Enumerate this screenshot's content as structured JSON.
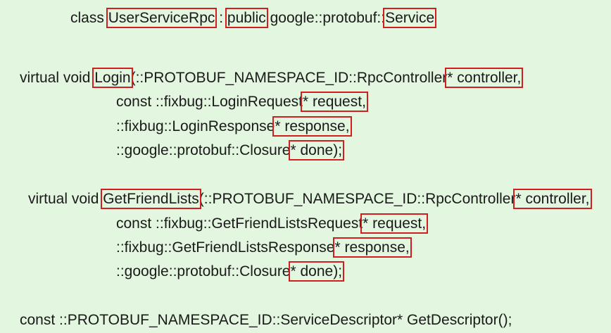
{
  "colors": {
    "background": "#e3f6df",
    "highlight_box": "#d11f1f",
    "text": "#1a1a1a"
  },
  "code": {
    "class_decl": {
      "kw": "class ",
      "name": "UserServiceRpc",
      "sep": " : ",
      "access": "public",
      "base_prefix": " google::protobuf::",
      "base": "Service"
    },
    "login": {
      "prefix": "virtual void ",
      "name": "Login",
      "param1": "(::PROTOBUF_NAMESPACE_ID::RpcController",
      "param1_var": "* controller,",
      "param2": "const ::fixbug::LoginRequest",
      "param2_var": "* request,",
      "param3": "::fixbug::LoginResponse",
      "param3_var": "* response,",
      "param4": "::google::protobuf::Closure",
      "param4_var": "* done);"
    },
    "friends": {
      "prefix": "virtual void ",
      "name": "GetFriendLists",
      "param1": "(::PROTOBUF_NAMESPACE_ID::RpcController",
      "param1_var": "* controller,",
      "param2": "const ::fixbug::GetFriendListsRequest",
      "param2_var": "* request,",
      "param3": "::fixbug::GetFriendListsResponse",
      "param3_var": "* response,",
      "param4": "::google::protobuf::Closure",
      "param4_var": "* done);"
    },
    "descriptor_line": "const ::PROTOBUF_NAMESPACE_ID::ServiceDescriptor* GetDescriptor();"
  }
}
